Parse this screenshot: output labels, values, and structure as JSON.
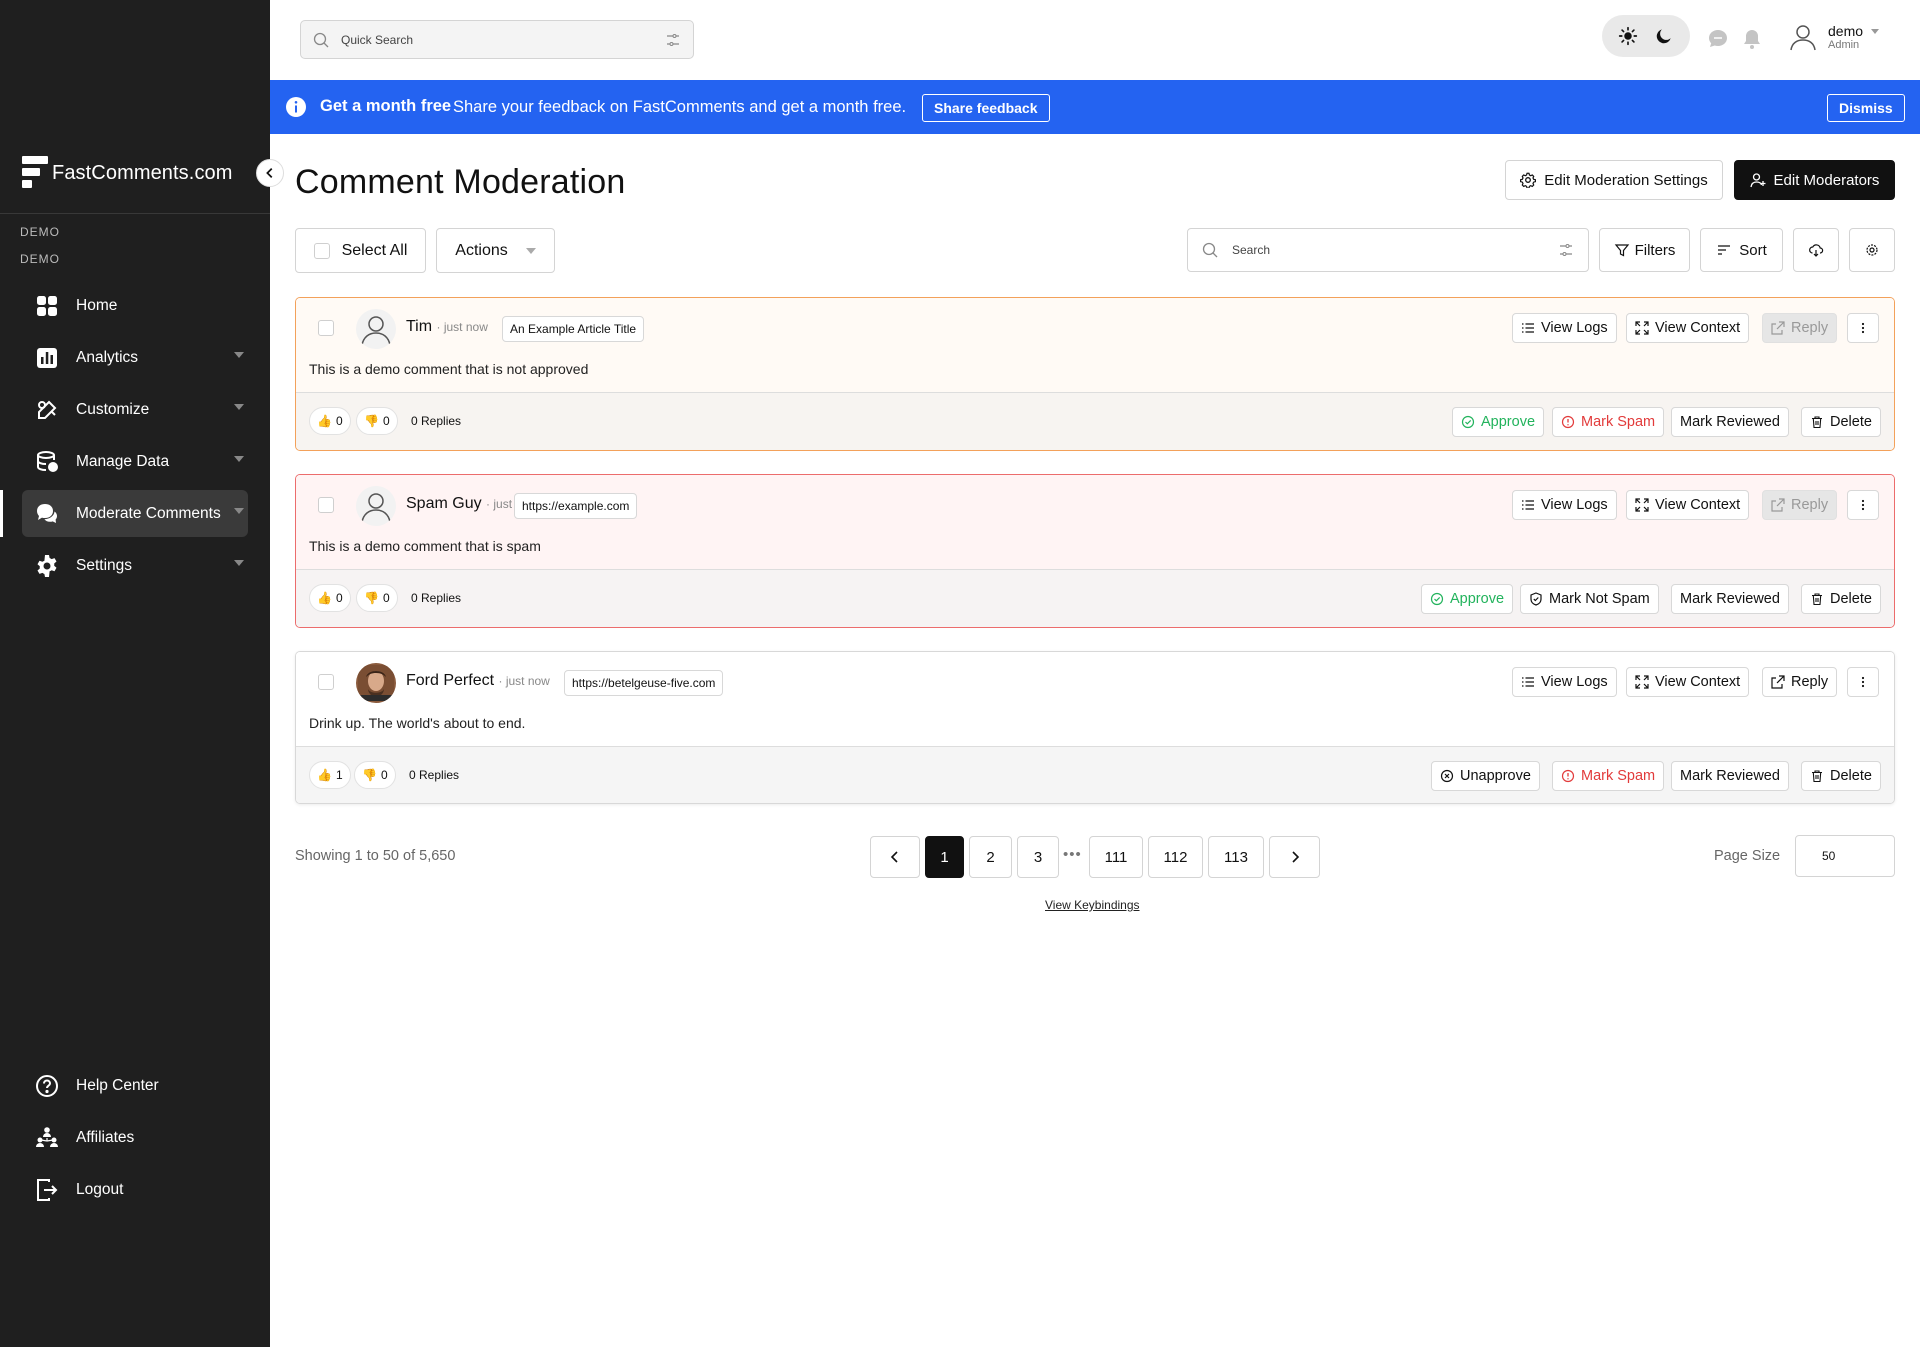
{
  "sidebar": {
    "brand": "FastComments.com",
    "tenant_line1": "DEMO",
    "tenant_line2": "DEMO",
    "nav": [
      {
        "label": "Home",
        "icon": "grid-icon"
      },
      {
        "label": "Analytics",
        "icon": "bar-chart-icon"
      },
      {
        "label": "Customize",
        "icon": "palette-icon"
      },
      {
        "label": "Manage Data",
        "icon": "database-icon"
      },
      {
        "label": "Moderate Comments",
        "icon": "chat-bubbles-icon",
        "active": true
      },
      {
        "label": "Settings",
        "icon": "gear-icon"
      }
    ],
    "bottom_nav": [
      {
        "label": "Help Center",
        "icon": "help-icon"
      },
      {
        "label": "Affiliates",
        "icon": "people-icon"
      },
      {
        "label": "Logout",
        "icon": "logout-icon"
      }
    ]
  },
  "topbar": {
    "quick_search_placeholder": "Quick Search",
    "user_name": "demo",
    "user_role": "Admin"
  },
  "banner": {
    "title": "Get a month free",
    "text": "Share your feedback on FastComments and get a month free.",
    "share_button": "Share feedback",
    "dismiss_button": "Dismiss",
    "color": "#2463f1"
  },
  "page": {
    "title": "Comment Moderation",
    "edit_settings_button": "Edit Moderation Settings",
    "edit_moderators_button": "Edit Moderators",
    "select_all": "Select All",
    "actions": "Actions",
    "search_placeholder": "Search",
    "filters": "Filters",
    "sort": "Sort"
  },
  "comments": [
    {
      "author": "Tim",
      "time": "· just now",
      "page": "An Example Article Title",
      "text": "This is a demo comment that is not approved",
      "likes": "0",
      "dislikes": "0",
      "replies": "0 Replies",
      "status": "pending",
      "actions": {
        "approve": "Approve",
        "spam": "Mark Spam",
        "reviewed": "Mark Reviewed",
        "delete": "Delete"
      }
    },
    {
      "author": "Spam Guy",
      "time": "· just now",
      "page": "https://example.com",
      "text": "This is a demo comment that is spam",
      "likes": "0",
      "dislikes": "0",
      "replies": "0 Replies",
      "status": "spam",
      "actions": {
        "approve": "Approve",
        "spam": "Mark Not Spam",
        "reviewed": "Mark Reviewed",
        "delete": "Delete"
      }
    },
    {
      "author": "Ford Perfect",
      "time": "· just now",
      "page": "https://betelgeuse-five.com",
      "text": "Drink up. The world's about to end.",
      "likes": "1",
      "dislikes": "0",
      "replies": "0 Replies",
      "status": "approved",
      "actions": {
        "approve": "Unapprove",
        "spam": "Mark Spam",
        "reviewed": "Mark Reviewed",
        "delete": "Delete"
      }
    }
  ],
  "card_actions": {
    "logs": "View Logs",
    "context": "View Context",
    "reply": "Reply"
  },
  "pagination": {
    "showing": "Showing 1 to 50 of 5,650",
    "pages": [
      "1",
      "2",
      "3",
      "111",
      "112",
      "113"
    ],
    "current": "1",
    "ellipsis": "•••",
    "page_size_label": "Page Size",
    "page_size": "50",
    "keybindings": "View Keybindings"
  }
}
